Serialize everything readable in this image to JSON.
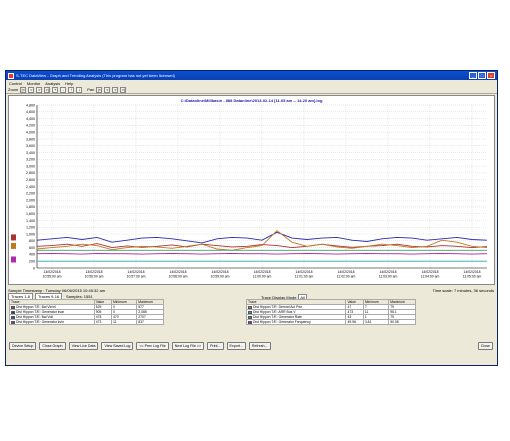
{
  "window": {
    "title": "S-TEC DataView - Graph and Trending Analysis (This program has not yet been licensed)",
    "controls": [
      "_",
      "□",
      "×"
    ]
  },
  "menu": [
    "Control",
    "Monitor",
    "Analysis",
    "Help"
  ],
  "toolbar": {
    "zoom_label": "Zoom",
    "zoom_buttons": [
      "|<",
      "<",
      ">",
      ">|",
      "+",
      "-",
      "↑",
      "↓"
    ],
    "pan_label": "Pan",
    "pan_buttons": [
      "|<",
      "<",
      ">",
      ">|"
    ]
  },
  "graph": {
    "title": "C:\\Datanline\\Millbasin - 888 Datanline\\2013-02-14 [11.05 am -- 14.20 am].log"
  },
  "chart_data": {
    "type": "line",
    "ylim": [
      0,
      4800
    ],
    "yticks": [
      "4,800",
      "4,600",
      "4,400",
      "4,200",
      "4,000",
      "3,800",
      "3,600",
      "3,400",
      "3,200",
      "3,000",
      "2,800",
      "2,600",
      "2,400",
      "2,200",
      "2,000",
      "1,800",
      "1,600",
      "1,400",
      "1,200",
      "1,000",
      "800",
      "600",
      "400",
      "200",
      "0"
    ],
    "xticks": [
      [
        "13/02/2018",
        "10:55:00 am"
      ],
      [
        "13/02/2018",
        "10:56:00 am"
      ],
      [
        "14/02/2018",
        "10:57:00 am"
      ],
      [
        "14/02/2018",
        "10:58:00 am"
      ],
      [
        "14/02/2018",
        "10:59:00 am"
      ],
      [
        "14/02/2018",
        "11:00:00 am"
      ],
      [
        "14/02/2018",
        "11:01:00 am"
      ],
      [
        "14/02/2018",
        "11:02:00 am"
      ],
      [
        "14/02/2018",
        "11:03:00 am"
      ],
      [
        "14/02/2018",
        "11:04:00 am"
      ],
      [
        "14/02/2018",
        "11:05:00 am"
      ]
    ],
    "grid": true,
    "series": [
      {
        "name": "Dist Hippon T/E: Bal Vin/el",
        "color": "#b03030",
        "values": [
          640,
          660,
          700,
          640,
          720,
          600,
          650,
          610,
          640,
          680,
          620,
          700,
          660,
          620,
          640,
          690,
          660,
          600,
          640,
          700,
          650,
          610,
          640,
          660,
          700,
          640,
          620,
          660,
          640,
          600,
          630
        ]
      },
      {
        "name": "Dist Hippon T/E: Bal Volt",
        "color": "#2a2ab0",
        "values": [
          820,
          860,
          900,
          840,
          900,
          760,
          820,
          880,
          900,
          860,
          800,
          740,
          860,
          900,
          880,
          820,
          1050,
          880,
          840,
          880,
          900,
          820,
          780,
          860,
          900,
          880,
          820,
          860,
          900,
          840,
          820
        ]
      },
      {
        "name": "Dist Hippon T/E: Generator kvar",
        "color": "#c07a20",
        "values": [
          560,
          600,
          640,
          700,
          660,
          540,
          600,
          640,
          620,
          580,
          640,
          700,
          560,
          520,
          600,
          660,
          1100,
          760,
          640,
          700,
          620,
          580,
          640,
          700,
          660,
          600,
          640,
          820,
          760,
          640,
          600
        ]
      },
      {
        "name": "Dist Hippon T/E: Generator Frequency",
        "color": "#3aa060",
        "values": [
          520,
          520,
          520,
          520,
          520,
          520,
          520,
          520,
          520,
          520,
          520,
          520,
          520,
          520,
          520,
          520,
          520,
          520,
          520,
          520,
          520,
          520,
          520,
          520,
          520,
          520,
          520,
          520,
          520,
          520,
          520
        ]
      },
      {
        "name": "Dist Hippon T/E: Generator Rate",
        "color": "#b02ab0",
        "values": [
          420,
          430,
          420,
          410,
          430,
          420,
          420,
          410,
          420,
          430,
          420,
          410,
          420,
          430,
          420,
          420,
          410,
          420,
          430,
          420,
          410,
          420,
          430,
          420,
          420,
          410,
          420,
          430,
          420,
          410,
          420
        ]
      },
      {
        "name": "Dist Hippon T/E: ARR Bus V",
        "color": "#20a8b8",
        "values": [
          200,
          200,
          200,
          200,
          200,
          200,
          200,
          200,
          200,
          200,
          200,
          200,
          200,
          200,
          200,
          200,
          200,
          200,
          200,
          200,
          200,
          200,
          200,
          200,
          200,
          200,
          200,
          200,
          200,
          200,
          200
        ]
      }
    ]
  },
  "status": {
    "sample_timestamp": "Sample Timestamp : Tuesday 06/06/2015 10:45:32 am",
    "time_scale": "Time scale: 7 minutes, 36 seconds",
    "samples_label": "Samples: 1551",
    "trace_display_mode_label": "Trace Display Mode",
    "trace_display_mode_value": "All"
  },
  "tabs": [
    "Traces 1-8",
    "Traces 9-16"
  ],
  "table_left": {
    "headers": [
      "Trace",
      "Value",
      "Minimum",
      "Maximum"
    ],
    "rows": [
      {
        "color": "#b03030",
        "name": "Dist Hippon T/E: Bal Vin/el",
        "value": "525",
        "min": "0",
        "max": "577"
      },
      {
        "color": "#2a2ab0",
        "name": "Dist Hippon T/E: Generator kvar",
        "value": "905",
        "min": "0",
        "max": "2,085"
      },
      {
        "color": "#3a3ad0",
        "name": "Dist Hippon T/E: Bal Volt",
        "value": "478",
        "min": "470",
        "max": "2707"
      },
      {
        "color": "#8a30c0",
        "name": "Dist Hippon T/E: Generator kvhr",
        "value": "473",
        "min": "11",
        "max": "837"
      }
    ]
  },
  "table_right": {
    "headers": [
      "Trace",
      "Value",
      "Minimum",
      "Maximum"
    ],
    "rows": [
      {
        "color": "#c07a20",
        "name": "Dist Hippon T/E: Demnd Act Pwr",
        "value": "47",
        "min": "7",
        "max": "79"
      },
      {
        "color": "#20a8b8",
        "name": "Dist Hippon T/E: ARR Bus V",
        "value": "473",
        "min": "11",
        "max": "96.1"
      },
      {
        "color": "#3aa060",
        "name": "Dist Hippon T/E: Generator Rate",
        "value": "43",
        "min": "1",
        "max": "79"
      },
      {
        "color": "#b02ab0",
        "name": "Dist Hippon T/E: Generator Frequency",
        "value": "49.96",
        "min": "3.81",
        "max": "50.08"
      }
    ]
  },
  "buttons": [
    "Device Setup",
    "Close Graph",
    "View Live Data",
    "View Saved Log",
    "<< Prev Log File",
    "Next Log File >>",
    "Print...",
    "Export...",
    "Refresh..."
  ],
  "close_button": "Close"
}
